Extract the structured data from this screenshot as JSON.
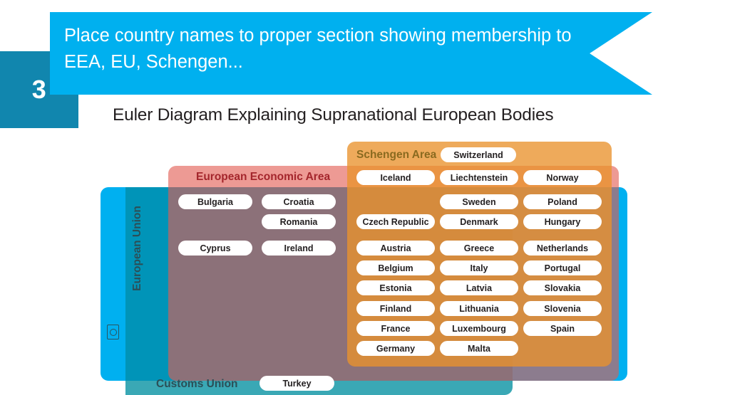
{
  "slide": {
    "number": "3",
    "instruction": "Place country names to proper section showing membership to EEA, EU, Schengen...",
    "title": "Euler Diagram Explaining Supranational European Bodies"
  },
  "sets": {
    "eu": {
      "label": "European Union",
      "color": "#00b0f0"
    },
    "customs_union": {
      "label": "Customs Union",
      "color": "#3aa8b5"
    },
    "eea": {
      "label": "European Economic Area",
      "color": "#e25c52"
    },
    "schengen": {
      "label": "Schengen Area",
      "color": "#e9922d"
    }
  },
  "members": {
    "customs_union_only": [
      "Turkey"
    ],
    "eea_and_eu": [
      "Bulgaria",
      "Croatia",
      "Romania",
      "Cyprus",
      "Ireland"
    ],
    "schengen_only": [
      "Switzerland"
    ],
    "schengen_and_eea": [
      "Iceland",
      "Liechtenstein",
      "Norway"
    ],
    "schengen_eea_eu": [
      "Sweden",
      "Poland",
      "Czech Republic",
      "Denmark",
      "Hungary",
      "Austria",
      "Greece",
      "Netherlands",
      "Belgium",
      "Italy",
      "Portugal",
      "Estonia",
      "Latvia",
      "Slovakia",
      "Finland",
      "Lithuania",
      "Slovenia",
      "France",
      "Luxembourg",
      "Spain",
      "Germany",
      "Malta"
    ]
  },
  "pills": {
    "switzerland": "Switzerland",
    "iceland": "Iceland",
    "liechtenstein": "Liechtenstein",
    "norway": "Norway",
    "sweden": "Sweden",
    "poland": "Poland",
    "czech_republic": "Czech Republic",
    "denmark": "Denmark",
    "hungary": "Hungary",
    "austria": "Austria",
    "greece": "Greece",
    "netherlands": "Netherlands",
    "belgium": "Belgium",
    "italy": "Italy",
    "portugal": "Portugal",
    "estonia": "Estonia",
    "latvia": "Latvia",
    "slovakia": "Slovakia",
    "finland": "Finland",
    "lithuania": "Lithuania",
    "slovenia": "Slovenia",
    "france": "France",
    "luxembourg": "Luxembourg",
    "spain": "Spain",
    "germany": "Germany",
    "malta": "Malta",
    "bulgaria": "Bulgaria",
    "croatia": "Croatia",
    "romania": "Romania",
    "cyprus": "Cyprus",
    "ireland": "Ireland",
    "turkey": "Turkey"
  }
}
